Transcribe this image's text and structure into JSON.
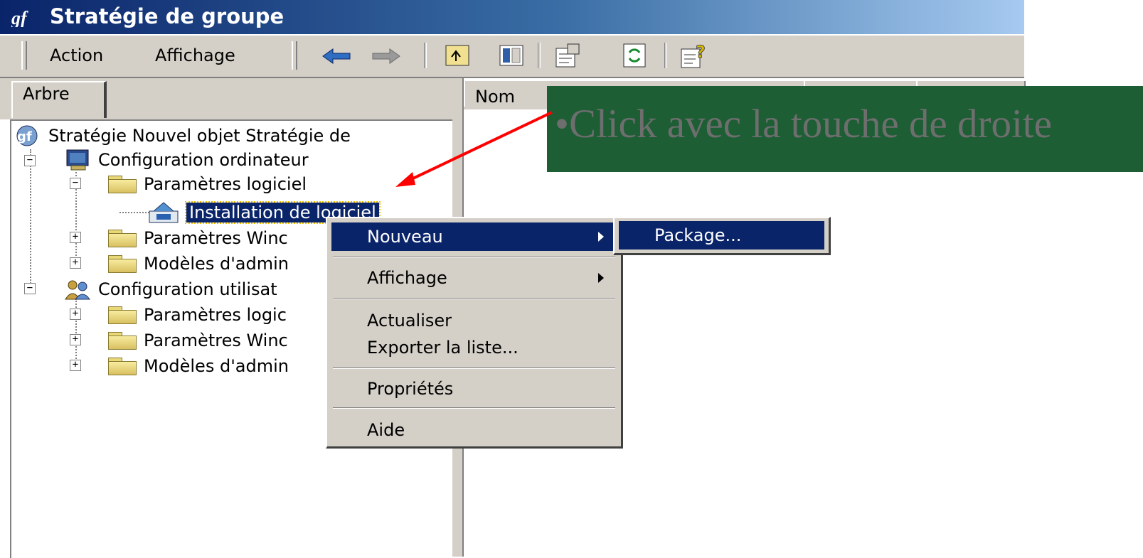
{
  "window": {
    "title": "Stratégie de groupe",
    "icon": "group-policy-icon"
  },
  "menubar": {
    "action": "Action",
    "affichage": "Affichage"
  },
  "toolbar": {
    "buttons": [
      "back-arrow-icon",
      "forward-arrow-icon",
      "up-folder-icon",
      "show-hide-tree-icon",
      "properties-icon",
      "refresh-icon",
      "help-icon"
    ]
  },
  "tabs": {
    "tree": "Arbre"
  },
  "tree": {
    "root": "Stratégie Nouvel objet Stratégie de",
    "computer_config": "Configuration ordinateur",
    "software_settings": "Paramètres logiciel",
    "software_install": "Installation de logiciel",
    "windows_settings": "Paramètres Winc",
    "admin_templates": "Modèles d'admin",
    "user_config": "Configuration utilisat",
    "user_software_settings": "Paramètres logic",
    "user_windows_settings": "Paramètres Winc",
    "user_admin_templates": "Modèles d'admin"
  },
  "list": {
    "col_name": "Nom"
  },
  "context_menu": {
    "nouveau": "Nouveau",
    "affichage": "Affichage",
    "actualiser": "Actualiser",
    "exporter": "Exporter la liste...",
    "proprietes": "Propriétés",
    "aide": "Aide"
  },
  "submenu": {
    "package": "Package..."
  },
  "callout": {
    "text": "•Click avec la touche de droite",
    "background": "#1d5e35",
    "arrow_color": "#ff0000"
  },
  "colors": {
    "selection": "#0a246a",
    "face": "#d4d0c8"
  }
}
